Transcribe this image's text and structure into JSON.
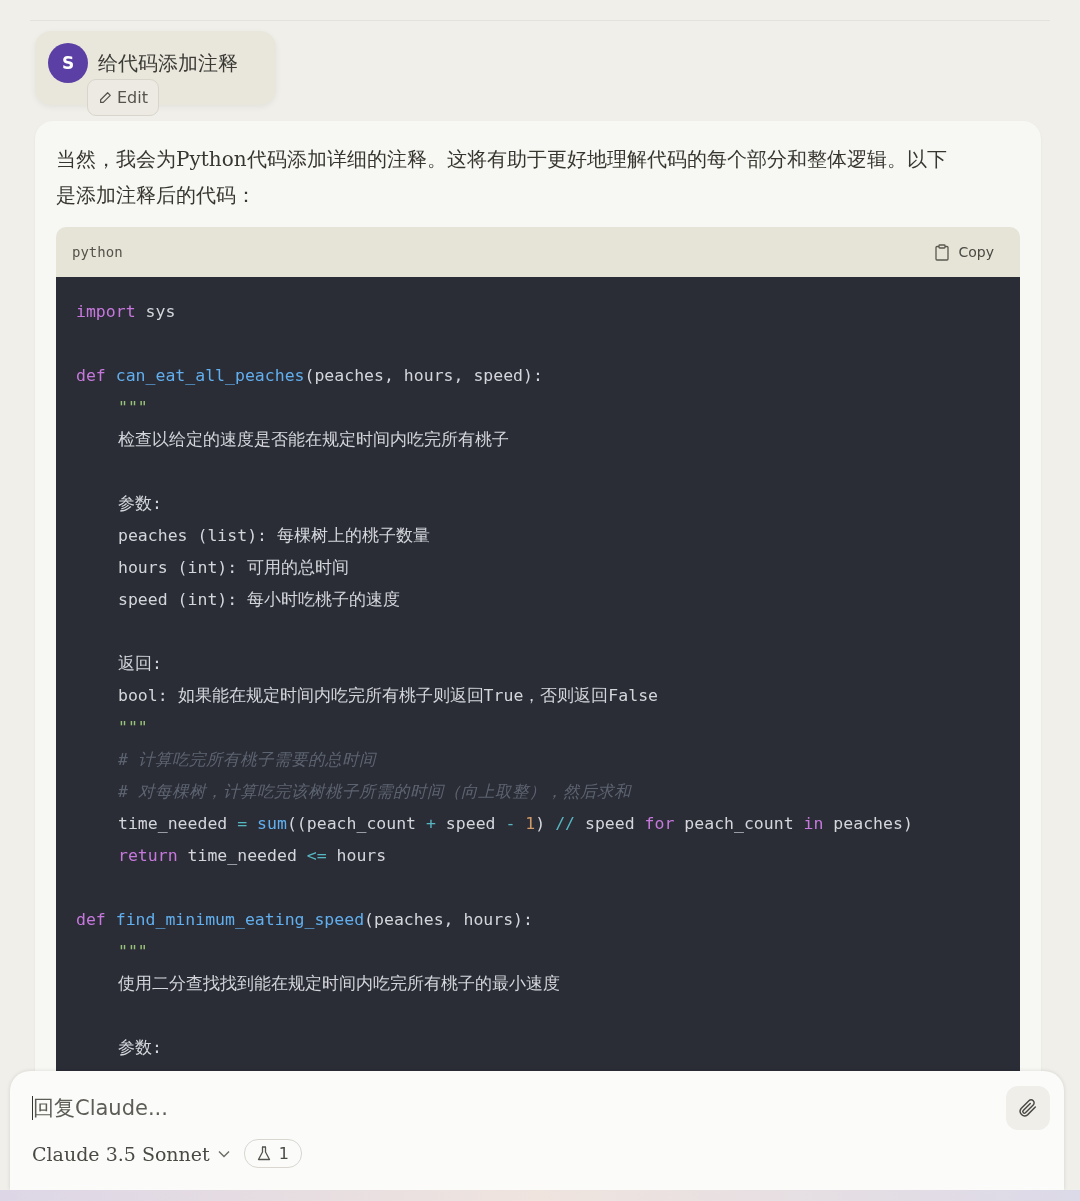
{
  "user_message": {
    "avatar_letter": "S",
    "text": "给代码添加注释",
    "edit_label": "Edit"
  },
  "response": {
    "intro": "当然，我会为Python代码添加详细的注释。这将有助于更好地理解代码的每个部分和整体逻辑。以下是添加注释后的代码：",
    "code_block": {
      "language": "python",
      "copy_label": "Copy",
      "lines": [
        {
          "kind": "code",
          "indented": false,
          "tokens": [
            {
              "kind": "keyword",
              "text": "import"
            },
            {
              "kind": "plain",
              "text": " sys"
            }
          ]
        },
        {
          "kind": "blank"
        },
        {
          "kind": "code",
          "indented": false,
          "tokens": [
            {
              "kind": "keyword",
              "text": "def "
            },
            {
              "kind": "function",
              "text": "can_eat_all_peaches"
            },
            {
              "kind": "plain",
              "text": "(peaches, hours, speed):"
            }
          ]
        },
        {
          "kind": "code",
          "indented": true,
          "tokens": [
            {
              "kind": "string",
              "text": "\"\"\""
            }
          ]
        },
        {
          "kind": "code",
          "indented": true,
          "tokens": [
            {
              "kind": "plain",
              "text": "检查以给定的速度是否能在规定时间内吃完所有桃子"
            }
          ]
        },
        {
          "kind": "blank"
        },
        {
          "kind": "code",
          "indented": true,
          "tokens": [
            {
              "kind": "plain",
              "text": "参数:"
            }
          ]
        },
        {
          "kind": "code",
          "indented": true,
          "tokens": [
            {
              "kind": "plain",
              "text": "peaches (list): 每棵树上的桃子数量"
            }
          ]
        },
        {
          "kind": "code",
          "indented": true,
          "tokens": [
            {
              "kind": "plain",
              "text": "hours (int): 可用的总时间"
            }
          ]
        },
        {
          "kind": "code",
          "indented": true,
          "tokens": [
            {
              "kind": "plain",
              "text": "speed (int): 每小时吃桃子的速度"
            }
          ]
        },
        {
          "kind": "blank"
        },
        {
          "kind": "code",
          "indented": true,
          "tokens": [
            {
              "kind": "plain",
              "text": "返回:"
            }
          ]
        },
        {
          "kind": "code",
          "indented": true,
          "tokens": [
            {
              "kind": "plain",
              "text": "bool: 如果能在规定时间内吃完所有桃子则返回True，否则返回False"
            }
          ]
        },
        {
          "kind": "code",
          "indented": true,
          "tokens": [
            {
              "kind": "string",
              "text": "\"\"\""
            }
          ]
        },
        {
          "kind": "code",
          "indented": true,
          "tokens": [
            {
              "kind": "comment",
              "text": "# 计算吃完所有桃子需要的总时间"
            }
          ]
        },
        {
          "kind": "code",
          "indented": true,
          "tokens": [
            {
              "kind": "comment",
              "text": "# 对每棵树，计算吃完该树桃子所需的时间（向上取整），然后求和"
            }
          ]
        },
        {
          "kind": "code",
          "indented": true,
          "tokens": [
            {
              "kind": "plain",
              "text": "time_needed "
            },
            {
              "kind": "operator",
              "text": "= "
            },
            {
              "kind": "builtin",
              "text": "sum"
            },
            {
              "kind": "plain",
              "text": "((peach_count "
            },
            {
              "kind": "operator",
              "text": "+"
            },
            {
              "kind": "plain",
              "text": " speed "
            },
            {
              "kind": "operator",
              "text": "- "
            },
            {
              "kind": "number",
              "text": "1"
            },
            {
              "kind": "plain",
              "text": ") "
            },
            {
              "kind": "operator",
              "text": "//"
            },
            {
              "kind": "plain",
              "text": " speed "
            },
            {
              "kind": "keyword",
              "text": "for"
            },
            {
              "kind": "plain",
              "text": " peach_count "
            },
            {
              "kind": "keyword",
              "text": "in"
            },
            {
              "kind": "plain",
              "text": " peaches)"
            }
          ]
        },
        {
          "kind": "code",
          "indented": true,
          "tokens": [
            {
              "kind": "keyword",
              "text": "return"
            },
            {
              "kind": "plain",
              "text": " time_needed "
            },
            {
              "kind": "operator",
              "text": "<="
            },
            {
              "kind": "plain",
              "text": " hours"
            }
          ]
        },
        {
          "kind": "blank"
        },
        {
          "kind": "code",
          "indented": false,
          "tokens": [
            {
              "kind": "keyword",
              "text": "def "
            },
            {
              "kind": "function",
              "text": "find_minimum_eating_speed"
            },
            {
              "kind": "plain",
              "text": "(peaches, hours):"
            }
          ]
        },
        {
          "kind": "code",
          "indented": true,
          "tokens": [
            {
              "kind": "string",
              "text": "\"\"\""
            }
          ]
        },
        {
          "kind": "code",
          "indented": true,
          "tokens": [
            {
              "kind": "plain",
              "text": "使用二分查找找到能在规定时间内吃完所有桃子的最小速度"
            }
          ]
        },
        {
          "kind": "blank"
        },
        {
          "kind": "code",
          "indented": true,
          "tokens": [
            {
              "kind": "plain",
              "text": "参数:"
            }
          ]
        }
      ]
    }
  },
  "composer": {
    "placeholder": "回复Claude...",
    "model": "Claude 3.5 Sonnet",
    "badge_count": "1"
  }
}
